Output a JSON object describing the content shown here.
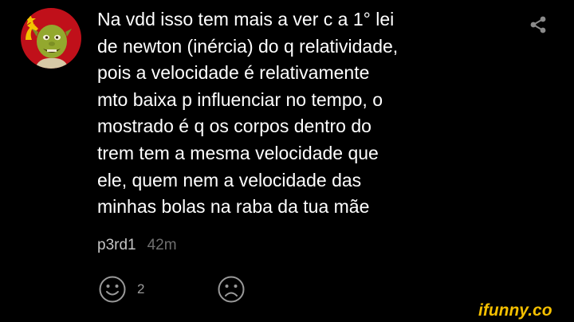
{
  "comment": {
    "text": "Na vdd isso tem mais a ver c a 1° lei\nde newton (inércia) do q relatividade,\npois a velocidade é relativamente\nmto baixa p influenciar no tempo, o\nmostrado é q os corpos dentro do\ntrem tem a mesma velocidade que\nele, quem nem a velocidade das\nminhas bolas na raba da tua mãe",
    "author": "p3rd1",
    "time": "42m",
    "smile_count": "2"
  },
  "icons": {
    "share": "share-icon",
    "smile": "smile-icon",
    "frown": "frown-icon"
  },
  "watermark": "ifunny.co",
  "colors": {
    "background": "#000000",
    "text": "#ffffff",
    "author": "#c4c4c4",
    "time": "#6f6f6f",
    "icon": "#9a9a9a",
    "watermark": "#f5c000",
    "avatar_bg": "#c0101a"
  }
}
